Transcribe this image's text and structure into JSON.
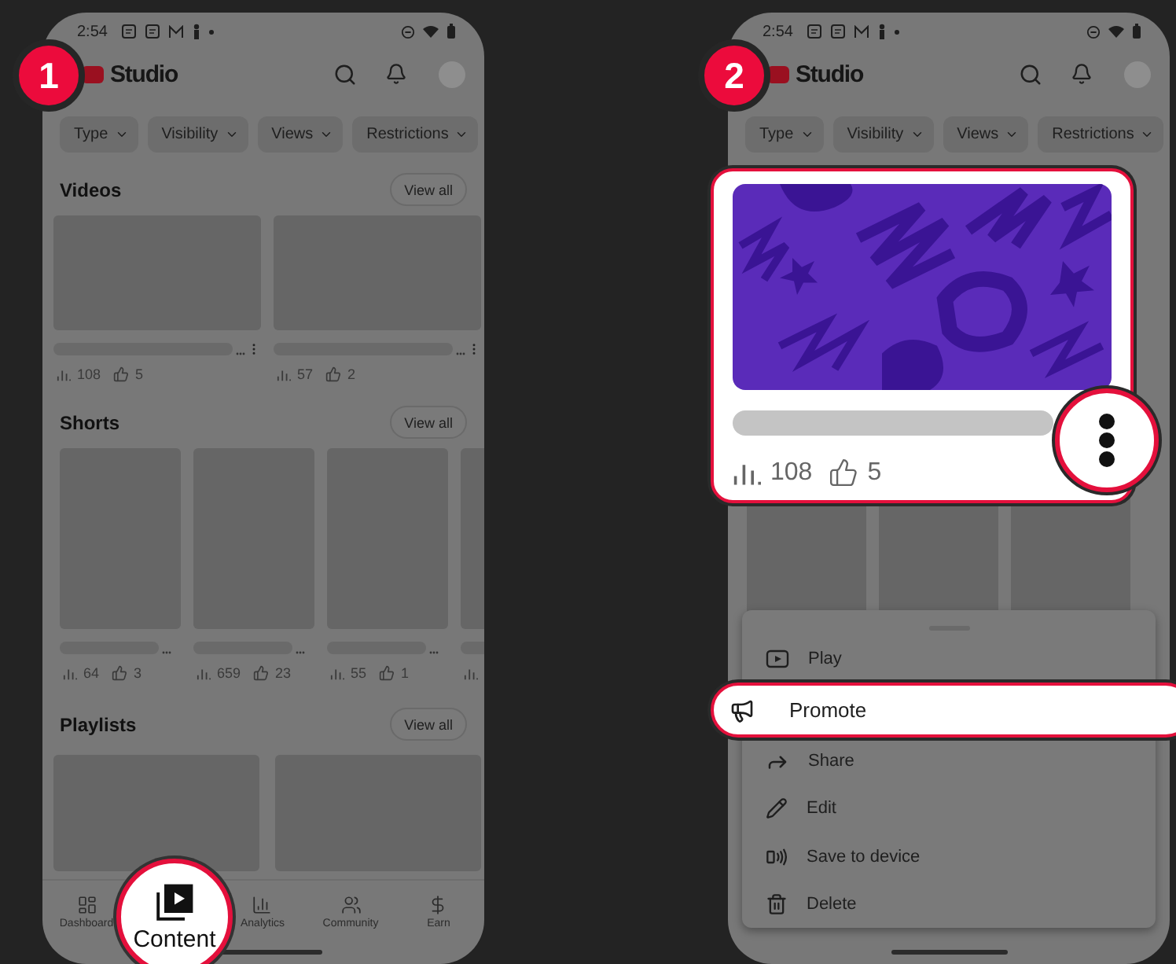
{
  "panels": [
    {
      "step": "1",
      "status_bar": {
        "time": "2:54"
      },
      "app_bar": {
        "title": "Studio"
      },
      "filters": [
        "Type",
        "Visibility",
        "Views",
        "Restrictions"
      ],
      "sections": [
        {
          "kind": "video",
          "title": "Videos",
          "action": "View all",
          "items": [
            {
              "views": "108",
              "likes": "5"
            },
            {
              "views": "57",
              "likes": "2"
            }
          ]
        },
        {
          "kind": "short",
          "title": "Shorts",
          "action": "View all",
          "items": [
            {
              "kind": "full",
              "views": "64",
              "likes": "3"
            },
            {
              "kind": "full",
              "views": "659",
              "likes": "23"
            },
            {
              "kind": "full",
              "views": "55",
              "likes": "1"
            },
            {
              "kind": "cut"
            }
          ]
        },
        {
          "kind": "playlist",
          "title": "Playlists",
          "action": "View all"
        }
      ],
      "bottom_nav": [
        {
          "label": "Dashboard",
          "selected": false,
          "magnified": false
        },
        {
          "label": "Content",
          "selected": true,
          "magnified": true
        },
        {
          "label": "Analytics",
          "selected": false,
          "magnified": false
        },
        {
          "label": "Community",
          "selected": false,
          "magnified": false
        },
        {
          "label": "Earn",
          "selected": false,
          "magnified": false
        }
      ]
    },
    {
      "step": "2",
      "status_bar": {
        "time": "2:54"
      },
      "app_bar": {
        "title": "Studio"
      },
      "filters": [
        "Type",
        "Visibility",
        "Views",
        "Restrictions"
      ],
      "highlighted_card": {
        "views": "108",
        "likes": "5"
      },
      "menu": [
        {
          "label": "Play",
          "highlighted": false
        },
        {
          "label": "Promote",
          "highlighted": true
        },
        {
          "label": "Share",
          "highlighted": false
        },
        {
          "label": "Edit",
          "highlighted": false
        },
        {
          "label": "Save to device",
          "highlighted": false
        },
        {
          "label": "Delete",
          "highlighted": false
        }
      ]
    }
  ]
}
